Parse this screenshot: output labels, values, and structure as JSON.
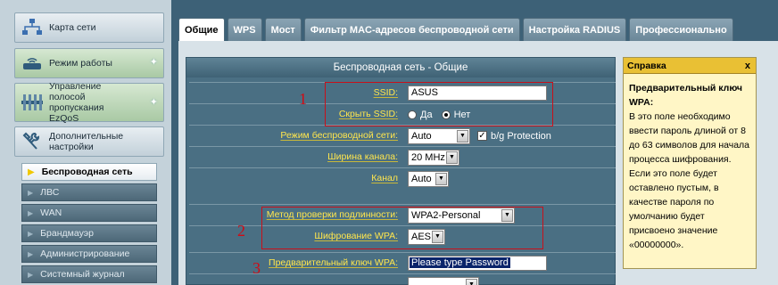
{
  "sidebar": {
    "big_items": [
      {
        "label": "Карта сети",
        "icon": "network-map-icon"
      },
      {
        "label": "Режим работы",
        "icon": "router-icon"
      },
      {
        "label": "Управление полосой пропускания EzQoS",
        "icon": "qos-icon"
      },
      {
        "label": "Дополнительные настройки",
        "icon": "tools-icon"
      }
    ],
    "sub_items": [
      {
        "label": "Беспроводная сеть",
        "active": true
      },
      {
        "label": "ЛВС"
      },
      {
        "label": "WAN"
      },
      {
        "label": "Брандмауэр"
      },
      {
        "label": "Администрирование"
      },
      {
        "label": "Системный журнал"
      }
    ]
  },
  "tabs": [
    "Общие",
    "WPS",
    "Мост",
    "Фильтр MAC-адресов беспроводной сети",
    "Настройка RADIUS",
    "Профессионально"
  ],
  "form": {
    "title": "Беспроводная сеть - Общие",
    "ssid_label": "SSID:",
    "ssid_value": "ASUS",
    "hide_ssid_label": "Скрыть SSID:",
    "hide_yes": "Да",
    "hide_no": "Нет",
    "hide_selected": "Нет",
    "mode_label": "Режим беспроводной сети:",
    "mode_value": "Auto",
    "bg_protection_label": "b/g Protection",
    "bg_protection_checked": true,
    "width_label": "Ширина канала:",
    "width_value": "20 MHz",
    "channel_label": "Канал",
    "channel_value": "Auto",
    "auth_label": "Метод проверки подлинности:",
    "auth_value": "WPA2-Personal",
    "enc_label": "Шифрование WPA:",
    "enc_value": "AES",
    "psk_label": "Предварительный ключ WPA:",
    "psk_value": "Please type Password"
  },
  "annotations": [
    "1",
    "2",
    "3"
  ],
  "help": {
    "title": "Справка",
    "close": "x",
    "heading": "Предварительный ключ WPA:",
    "text": "В это поле необходимо ввести пароль длиной от 8 до 63 символов для начала процесса шифрования. Если это поле будет оставлено пустым, в качестве пароля по умолчанию будет присвоено значение «00000000»."
  },
  "colors": {
    "accent_red": "#c8101a",
    "label_yellow": "#ffe64d",
    "panel_blue": "#4a6f83"
  }
}
